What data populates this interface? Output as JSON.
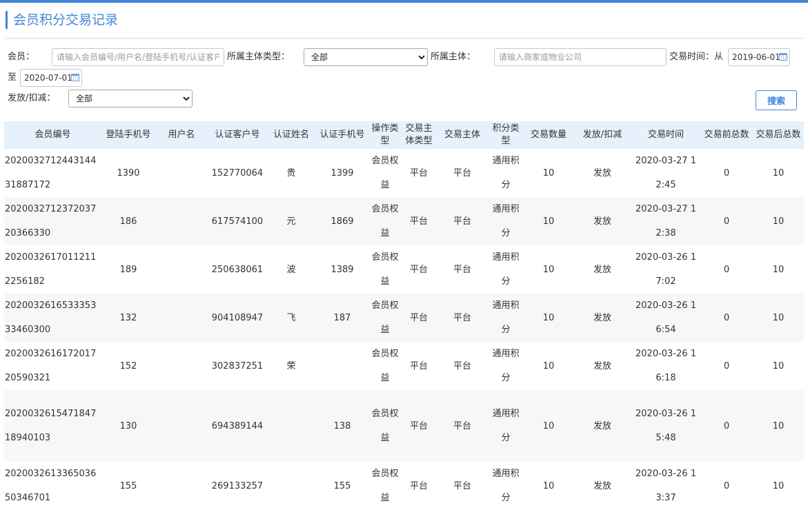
{
  "page": {
    "title": "会员积分交易记录"
  },
  "colors": {
    "accent": "#3f86d8",
    "header_bg": "#e6f1fc"
  },
  "filters": {
    "member_label": "会员：",
    "member_placeholder": "请输入会员编号/用户名/登陆手机号/认证客户号",
    "subject_type_label": "所属主体类型：",
    "subject_type_value": "全部",
    "subject_label": "所属主体：",
    "subject_placeholder": "请输入商家或物业公司",
    "time_label": "交易时间：从",
    "time_from": "2019-06-01",
    "to_label": "至",
    "time_to": "2020-07-01",
    "issue_label": "发放/扣减：",
    "issue_value": "全部",
    "search_label": "搜索"
  },
  "table": {
    "headers": [
      "会员编号",
      "登陆手机号",
      "用户名",
      "认证客户号",
      "认证姓名",
      "认证手机号",
      "操作类型",
      "交易主体类型",
      "交易主体",
      "积分类型",
      "交易数量",
      "发放/扣减",
      "交易时间",
      "交易前总数",
      "交易后总数"
    ],
    "rows": [
      {
        "member_id": "202003271244314431887172",
        "login_phone": "1390",
        "username": "",
        "cust_no": "152770064",
        "auth_name": "贵",
        "auth_phone": "1399",
        "op_type": "会员权益",
        "subject_type": "平台",
        "subject": "平台",
        "points_type": "通用积分",
        "qty": "10",
        "action": "发放",
        "time": "2020-03-27 12:45",
        "before": "0",
        "after": "10"
      },
      {
        "member_id": "202003271237203720366330",
        "login_phone": "186",
        "username": "",
        "cust_no": "617574100",
        "auth_name": "元",
        "auth_phone": "1869",
        "op_type": "会员权益",
        "subject_type": "平台",
        "subject": "平台",
        "points_type": "通用积分",
        "qty": "10",
        "action": "发放",
        "time": "2020-03-27 12:38",
        "before": "0",
        "after": "10"
      },
      {
        "member_id": "20200326170112112256182",
        "login_phone": "189",
        "username": "",
        "cust_no": "250638061",
        "auth_name": "波",
        "auth_phone": "1389",
        "op_type": "会员权益",
        "subject_type": "平台",
        "subject": "平台",
        "points_type": "通用积分",
        "qty": "10",
        "action": "发放",
        "time": "2020-03-26 17:02",
        "before": "0",
        "after": "10"
      },
      {
        "member_id": "202003261653335333460300",
        "login_phone": "132",
        "username": "",
        "cust_no": "904108947",
        "auth_name": "飞",
        "auth_phone": "187",
        "op_type": "会员权益",
        "subject_type": "平台",
        "subject": "平台",
        "points_type": "通用积分",
        "qty": "10",
        "action": "发放",
        "time": "2020-03-26 16:54",
        "before": "0",
        "after": "10"
      },
      {
        "member_id": "202003261617201720590321",
        "login_phone": "152",
        "username": "",
        "cust_no": "302837251",
        "auth_name": "荣",
        "auth_phone": "",
        "op_type": "会员权益",
        "subject_type": "平台",
        "subject": "平台",
        "points_type": "通用积分",
        "qty": "10",
        "action": "发放",
        "time": "2020-03-26 16:18",
        "before": "0",
        "after": "10"
      },
      {
        "member_id": "202003261547184718940103",
        "login_phone": "130",
        "username": "",
        "cust_no": "694389144",
        "auth_name": "",
        "auth_phone": "138",
        "op_type": "会员权益",
        "subject_type": "平台",
        "subject": "平台",
        "points_type": "通用积分",
        "qty": "10",
        "action": "发放",
        "time": "2020-03-26 15:48",
        "before": "0",
        "after": "10"
      },
      {
        "member_id": "202003261336503650346701",
        "login_phone": "155",
        "username": "",
        "cust_no": "269133257",
        "auth_name": "",
        "auth_phone": "155",
        "op_type": "会员权益",
        "subject_type": "平台",
        "subject": "平台",
        "points_type": "通用积分",
        "qty": "10",
        "action": "发放",
        "time": "2020-03-26 13:37",
        "before": "0",
        "after": "10"
      }
    ]
  }
}
